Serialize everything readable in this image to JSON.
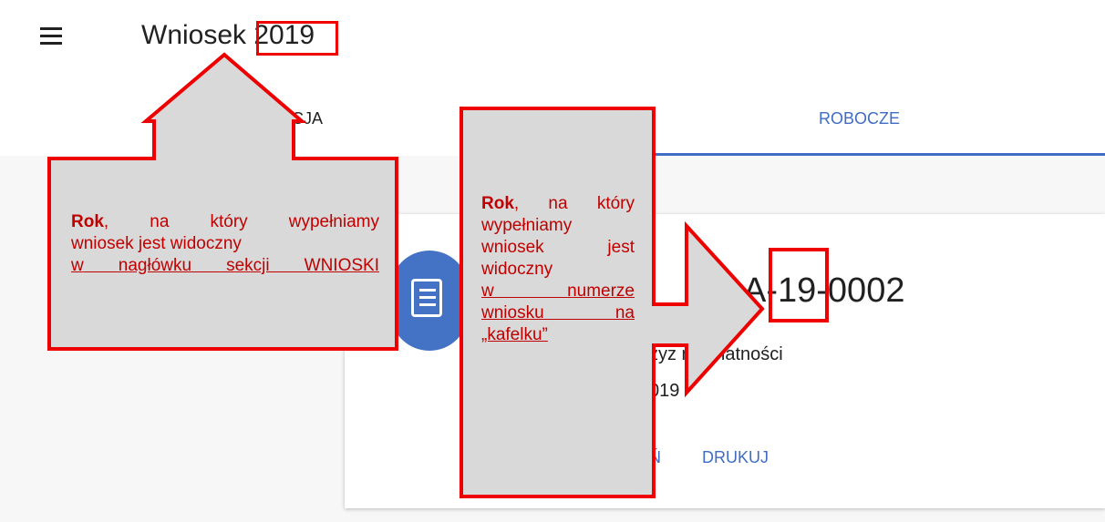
{
  "header": {
    "menu_icon": "hamburger-menu-icon",
    "title": "Wniosek 2019"
  },
  "tabs": [
    {
      "label": "Aktualizacja",
      "active": false
    },
    {
      "label": "Robocze",
      "active": true
    }
  ],
  "card": {
    "icon": "document-list-icon",
    "number_visible": "A-19-0002",
    "type_visible": "zyz    nie płatności",
    "year_visible": "019",
    "actions": [
      {
        "label": "Ń"
      },
      {
        "label": "DRUKUJ"
      }
    ]
  },
  "annotations": {
    "callout_header": {
      "bold": "Rok",
      "line1_rest": ", na który wypełniamy",
      "line2": "wniosek jest widoczny",
      "link": "w nagłówku sekcji WNIOSKI"
    },
    "callout_number": {
      "bold": "Rok",
      "line1_rest": ", na który",
      "line2": "wypełniamy",
      "line3": "wniosek jest",
      "line4": "widoczny",
      "link1": "w numerze",
      "link2": "wniosku na",
      "link3": "„kafelku”"
    }
  },
  "colors": {
    "accent_blue": "#3f6cc4",
    "avatar_blue": "#4472c4",
    "highlight_red": "#ee0000",
    "callout_fill": "#d9d9d9",
    "callout_text": "#c00000"
  }
}
